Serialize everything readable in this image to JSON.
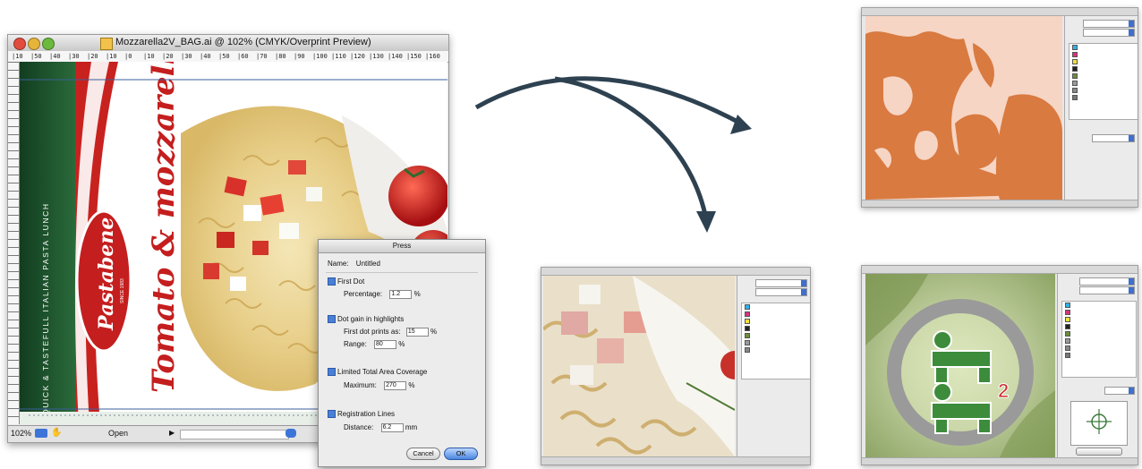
{
  "window": {
    "title": "Mozzarella2V_BAG.ai @ 102% (CMYK/Overprint Preview)",
    "ruler_ticks": [
      "|10",
      "|50",
      "|40",
      "|30",
      "|20",
      "|10",
      "|0",
      "|10",
      "|20",
      "|30",
      "|40",
      "|50",
      "|60",
      "|70",
      "|80",
      "|90",
      "|100",
      "|110",
      "|120",
      "|130",
      "|140",
      "|150",
      "|160"
    ],
    "status": {
      "zoom": "102%",
      "mode": "Open"
    },
    "artwork": {
      "brand": "Pastabene",
      "since": "SINCE 1983",
      "tagline": "QUICK & TASTEFULL ITALIAN PASTA LUNCH",
      "product": "Tomato & mozzarella"
    }
  },
  "press_dialog": {
    "title": "Press",
    "name_label": "Name:",
    "name_value": "Untitled",
    "first_dot": {
      "label": "First Dot",
      "percentage_label": "Percentage:",
      "percentage_value": "1.2",
      "unit": "%"
    },
    "dot_gain": {
      "label": "Dot gain in highlights",
      "first_dot_label": "First dot prints as:",
      "first_dot_value": "15",
      "range_label": "Range:",
      "range_value": "80",
      "unit": "%"
    },
    "tac": {
      "label": "Limited Total Area Coverage",
      "maximum_label": "Maximum:",
      "maximum_value": "270",
      "unit": "%"
    },
    "registration": {
      "label": "Registration Lines",
      "distance_label": "Distance:",
      "distance_value": "6.2",
      "unit": "mm"
    },
    "cancel_label": "Cancel",
    "ok_label": "OK"
  },
  "colors": {
    "arrow": "#2e4150",
    "brand_green": "#1f5c2e",
    "brand_red": "#c41e1e",
    "tac_orange": "#d97a40",
    "tac_bg": "#f6d5c4",
    "dot_green": "#3c8c3c"
  },
  "icons": [
    "close-icon",
    "minimize-icon",
    "zoom-icon",
    "document-icon",
    "arrow-icon",
    "crosshair-icon",
    "person-icon"
  ]
}
